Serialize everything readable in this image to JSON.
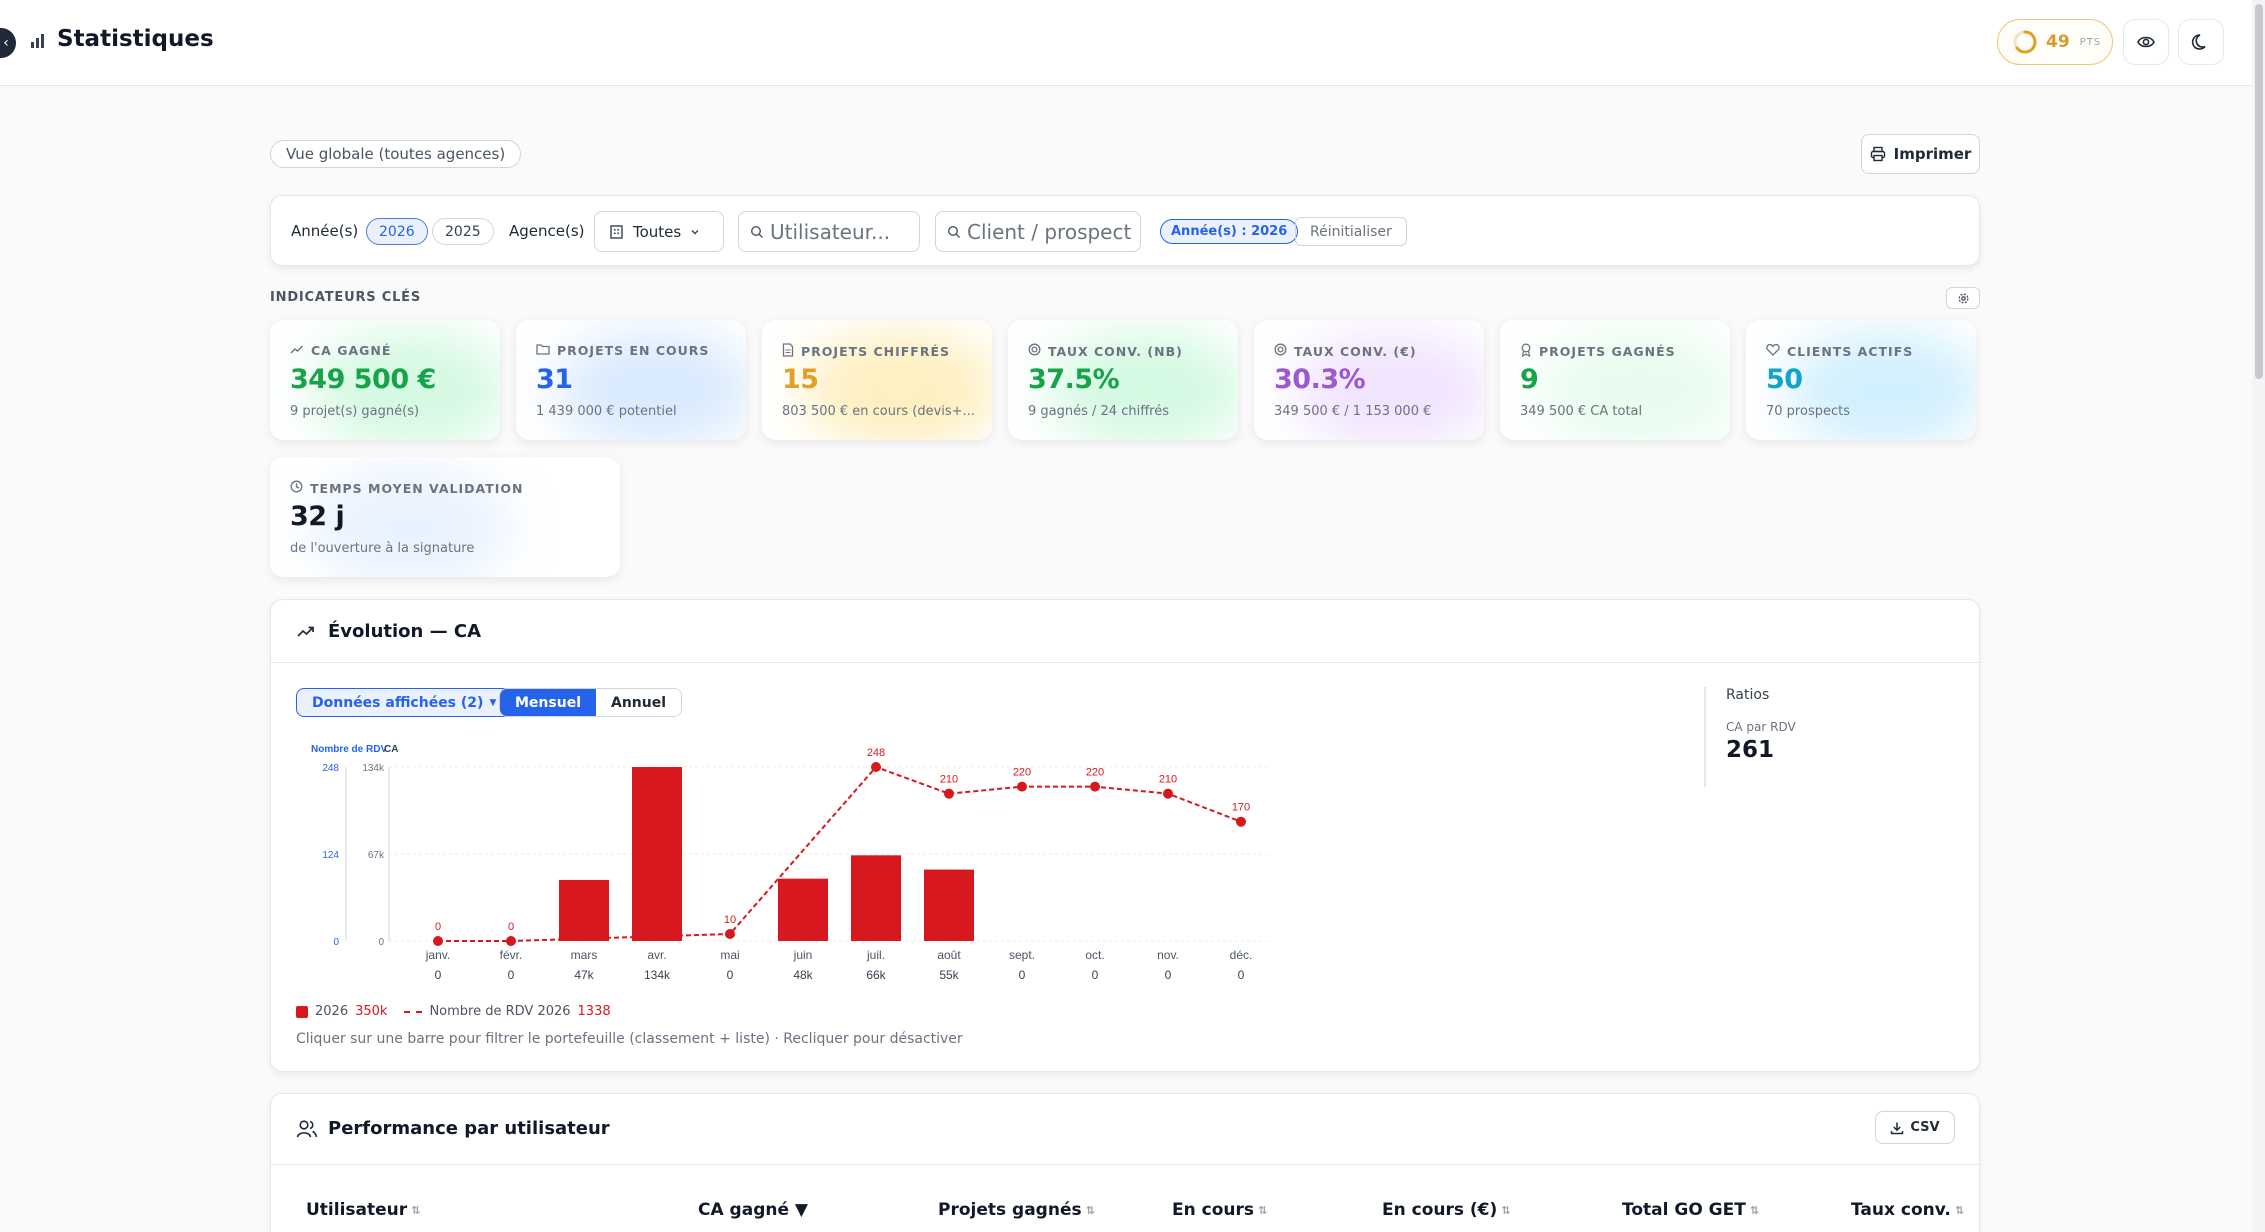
{
  "header": {
    "title": "Statistiques",
    "points_value": "49",
    "points_unit": "PTS"
  },
  "scope": {
    "label": "Vue globale (toutes agences)"
  },
  "toolbar": {
    "print_label": "Imprimer"
  },
  "filters": {
    "years_label": "Année(s)",
    "years": [
      "2026",
      "2025"
    ],
    "agency_label": "Agence(s)",
    "agency_value": "Toutes",
    "user_placeholder": "Utilisateur...",
    "client_placeholder": "Client / prospect",
    "active_filter": "Année(s) : 2026",
    "reset_label": "Réinitialiser"
  },
  "kpis": {
    "section_title": "INDICATEURS CLÉS",
    "items": [
      {
        "title": "CA GAGNÉ",
        "value": "349 500 €",
        "sub": "9 projet(s) gagné(s)",
        "color": "#16a34a",
        "glow": "#86efac"
      },
      {
        "title": "PROJETS EN COURS",
        "value": "31",
        "sub": "1 439 000 € potentiel",
        "color": "#2563eb",
        "glow": "#93c5fd"
      },
      {
        "title": "PROJETS CHIFFRÉS",
        "value": "15",
        "sub": "803 500 € en cours (devis+...",
        "color": "#e0a126",
        "glow": "#fcd34d"
      },
      {
        "title": "TAUX CONV. (NB)",
        "value": "37.5%",
        "sub": "9 gagnés / 24 chiffrés",
        "color": "#16a34a",
        "glow": "#86efac"
      },
      {
        "title": "TAUX CONV. (€)",
        "value": "30.3%",
        "sub": "349 500 € / 1 153 000 €",
        "color": "#9b59d0",
        "glow": "#d8b4fe"
      },
      {
        "title": "PROJETS GAGNÉS",
        "value": "9",
        "sub": "349 500 € CA total",
        "color": "#16a34a",
        "glow": "#bbf7d0"
      },
      {
        "title": "CLIENTS ACTIFS",
        "value": "50",
        "sub": "70 prospects",
        "color": "#0ea5c6",
        "glow": "#7dd3fc"
      },
      {
        "title": "TEMPS MOYEN VALIDATION",
        "value": "32 j",
        "sub": "de l'ouverture à la signature",
        "color": "#111827",
        "glow": "#bfdbfe"
      }
    ]
  },
  "evolution": {
    "title": "Évolution — CA",
    "data_dropdown": "Données affichées (2)",
    "view_monthly": "Mensuel",
    "view_yearly": "Annuel",
    "ratios_title": "Ratios",
    "ratio_label": "CA par RDV",
    "ratio_value": "261",
    "legend_ca_label": "2026",
    "legend_ca_total": "350k",
    "legend_rdv_label": "Nombre de RDV 2026",
    "legend_rdv_total": "1338",
    "hint": "Cliquer sur une barre pour filtrer le portefeuille (classement + liste) · Recliquer pour désactiver"
  },
  "chart_data": {
    "type": "bar",
    "categories": [
      "janv.",
      "févr.",
      "mars",
      "avr.",
      "mai",
      "juin",
      "juil.",
      "août",
      "sept.",
      "oct.",
      "nov.",
      "déc."
    ],
    "category_values": [
      "0",
      "0",
      "47k",
      "134k",
      "0",
      "48k",
      "66k",
      "55k",
      "0",
      "0",
      "0",
      "0"
    ],
    "series": [
      {
        "name": "2026",
        "type": "bar",
        "axis": "right",
        "values": [
          0,
          0,
          47000,
          134000,
          0,
          48000,
          66000,
          55000,
          0,
          0,
          0,
          0
        ]
      },
      {
        "name": "Nombre de RDV 2026",
        "type": "line",
        "axis": "left",
        "values": [
          0,
          0,
          null,
          null,
          10,
          null,
          248,
          210,
          220,
          220,
          210,
          170
        ]
      }
    ],
    "line_labels": [
      "0",
      "0",
      "",
      "",
      "10",
      "",
      "248",
      "210",
      "220",
      "220",
      "210",
      "170"
    ],
    "y_left": {
      "label": "Nombre de RDV",
      "ticks": [
        "248",
        "124",
        "0"
      ],
      "range": [
        0,
        248
      ]
    },
    "y_right": {
      "label": "CA",
      "ticks": [
        "134k",
        "67k",
        "0"
      ],
      "range": [
        0,
        134000
      ]
    },
    "bar_color": "#d7181e",
    "line_color": "#d7181e"
  },
  "performance": {
    "title": "Performance par utilisateur",
    "csv_label": "CSV",
    "columns": [
      "Utilisateur",
      "CA gagné ▼",
      "Projets gagnés",
      "En cours",
      "En cours (€)",
      "Total GO GET",
      "Taux conv."
    ]
  },
  "colors": {
    "accent": "#2563eb",
    "chart_red": "#d7181e",
    "points": "#d99a2b"
  }
}
